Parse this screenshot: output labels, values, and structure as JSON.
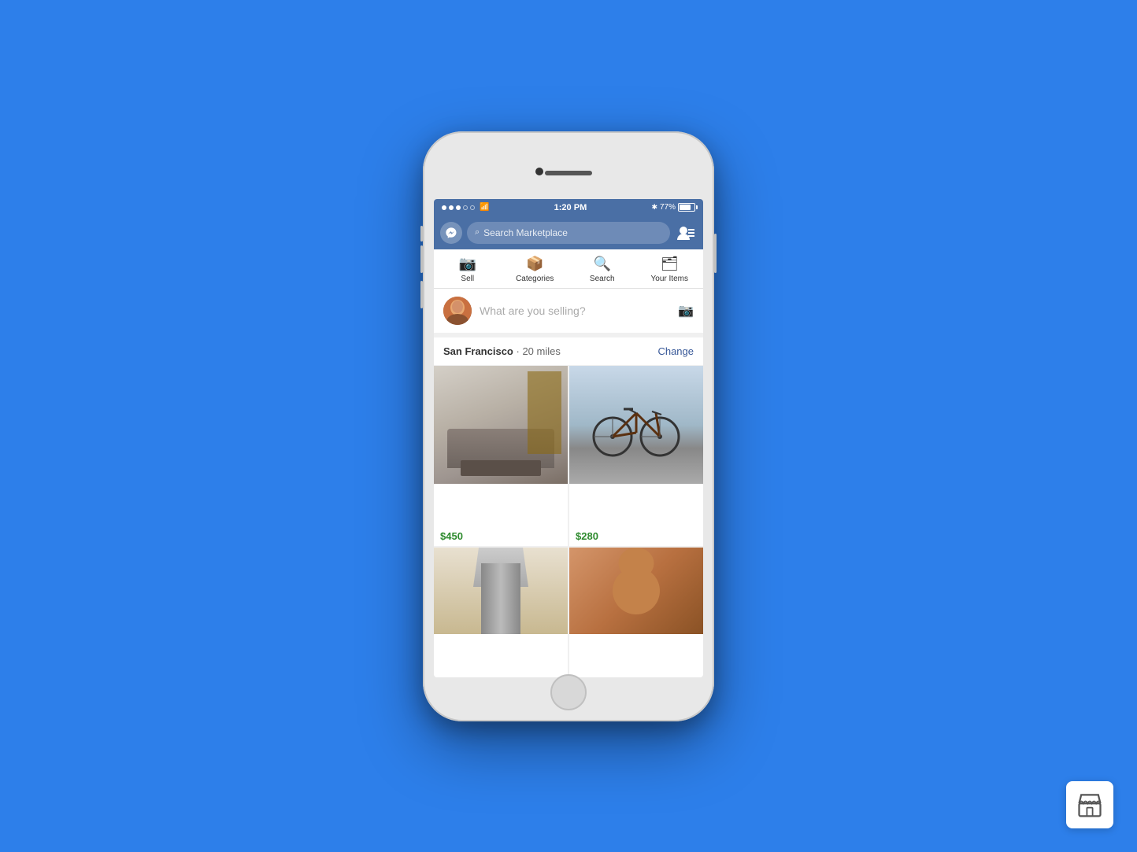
{
  "background_color": "#2D7FEA",
  "status_bar": {
    "time": "1:20 PM",
    "battery_percent": "77%",
    "signal_dots": [
      "filled",
      "filled",
      "filled",
      "empty",
      "empty"
    ],
    "wifi": "wifi",
    "bluetooth": "bluetooth"
  },
  "header": {
    "search_placeholder": "Search Marketplace"
  },
  "tabs": [
    {
      "label": "Sell",
      "icon": "camera"
    },
    {
      "label": "Categories",
      "icon": "star-box"
    },
    {
      "label": "Search",
      "icon": "search"
    },
    {
      "label": "Your Items",
      "icon": "list-box"
    }
  ],
  "sell_area": {
    "placeholder": "What are you selling?"
  },
  "location": {
    "name": "San Francisco",
    "miles": "20 miles",
    "change_label": "Change"
  },
  "listings": [
    {
      "type": "sofa",
      "price": "$450"
    },
    {
      "type": "bike",
      "price": "$280"
    },
    {
      "type": "lamp",
      "price": ""
    },
    {
      "type": "teddy",
      "price": ""
    }
  ]
}
